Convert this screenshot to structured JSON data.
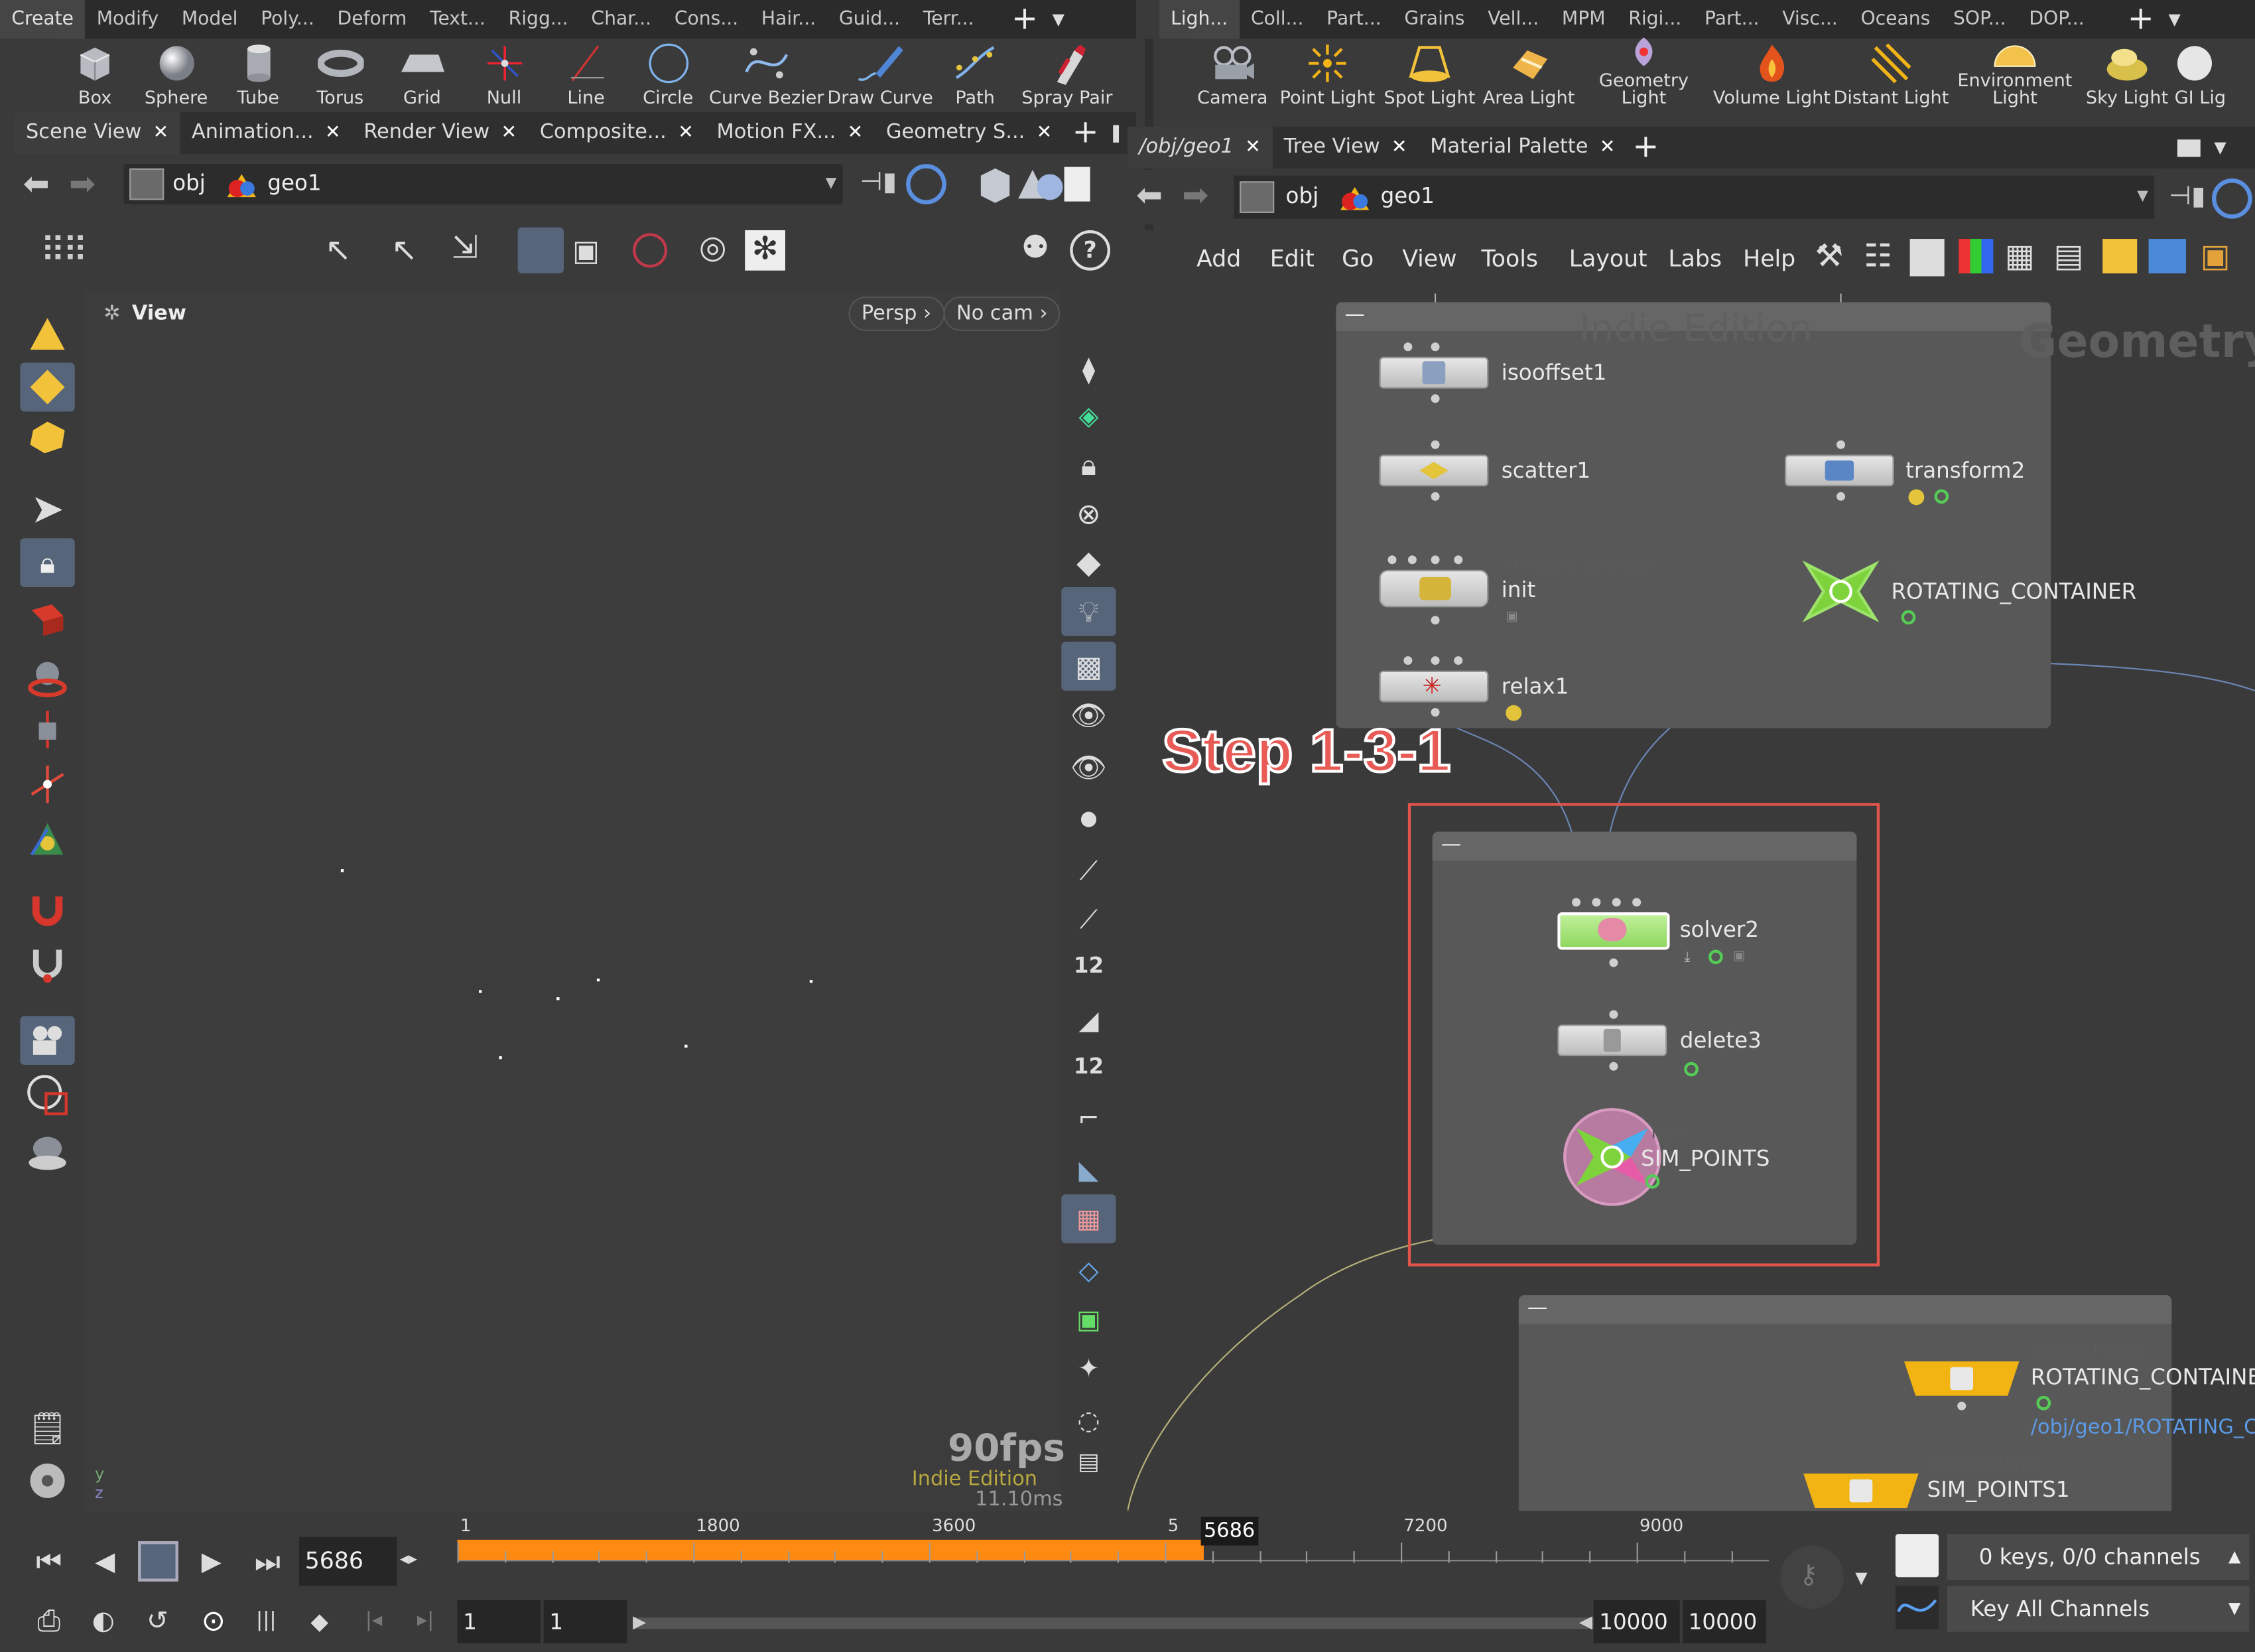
{
  "shelf_left": {
    "tabs": [
      "Create",
      "Modify",
      "Model",
      "Poly...",
      "Deform",
      "Text...",
      "Rigg...",
      "Char...",
      "Cons...",
      "Hair...",
      "Guid...",
      "Terr..."
    ],
    "tools": [
      "Box",
      "Sphere",
      "Tube",
      "Torus",
      "Grid",
      "Null",
      "Line",
      "Circle",
      "Curve Bezier",
      "Draw Curve",
      "Path",
      "Spray Pair"
    ]
  },
  "shelf_right": {
    "tabs": [
      "Ligh...",
      "Coll...",
      "Part...",
      "Grains",
      "Vell...",
      "MPM",
      "Rigi...",
      "Part...",
      "Visc...",
      "Oceans",
      "SOP...",
      "DOP..."
    ],
    "tools": [
      "Camera",
      "Point Light",
      "Spot Light",
      "Area Light",
      "Geometry Light",
      "Volume Light",
      "Distant Light",
      "Environment Light",
      "Sky Light",
      "GI Lig"
    ]
  },
  "left_pane": {
    "tabs": [
      "Scene View",
      "Animation...",
      "Render View",
      "Composite...",
      "Motion FX...",
      "Geometry S..."
    ],
    "path": {
      "obj": "obj",
      "geo": "geo1"
    },
    "view_label": "View",
    "persp": "Persp",
    "cam": "No cam",
    "fps": "90fps",
    "edition": "Indie Edition",
    "ms": "11.10ms",
    "snap_count_a": "12",
    "snap_count_b": "12"
  },
  "right_pane": {
    "tabs": [
      "/obj/geo1",
      "Tree View",
      "Material Palette"
    ],
    "path": {
      "obj": "obj",
      "geo": "geo1"
    },
    "menu": [
      "Add",
      "Edit",
      "Go",
      "View",
      "Tools",
      "Layout",
      "Labs",
      "Help"
    ],
    "watermark_edition": "Indie Edition",
    "watermark_context": "Geometry",
    "annotation": "Step 1-3-1",
    "nodes": {
      "isooffset1": "isooffset1",
      "scatter1": "scatter1",
      "transform2": "transform2",
      "init_type": "Attribute Wrangle",
      "init": "init",
      "null_type": "Null",
      "rotating": "ROTATING_CONTAINER",
      "relax1": "relax1",
      "solver2": "solver2",
      "delete3": "delete3",
      "sim_null_type": "Null",
      "sim_points": "SIM_POINTS",
      "objmerge_type": "Object Merge",
      "objmerge1": "ROTATING_CONTAINE",
      "objmerge1_path": "/obj/geo1/ROTATING_C",
      "objmerge2": "SIM_POINTS1"
    }
  },
  "timeline": {
    "current_frame": "5686",
    "marker": "5686",
    "ticks": [
      "1",
      "1800",
      "3600",
      "5",
      "7200",
      "9000"
    ],
    "start": "1",
    "start2": "1",
    "end": "10000",
    "end2": "10000",
    "progress": 0.5686,
    "keys": "0 keys, 0/0 channels",
    "key_all": "Key All Channels"
  }
}
